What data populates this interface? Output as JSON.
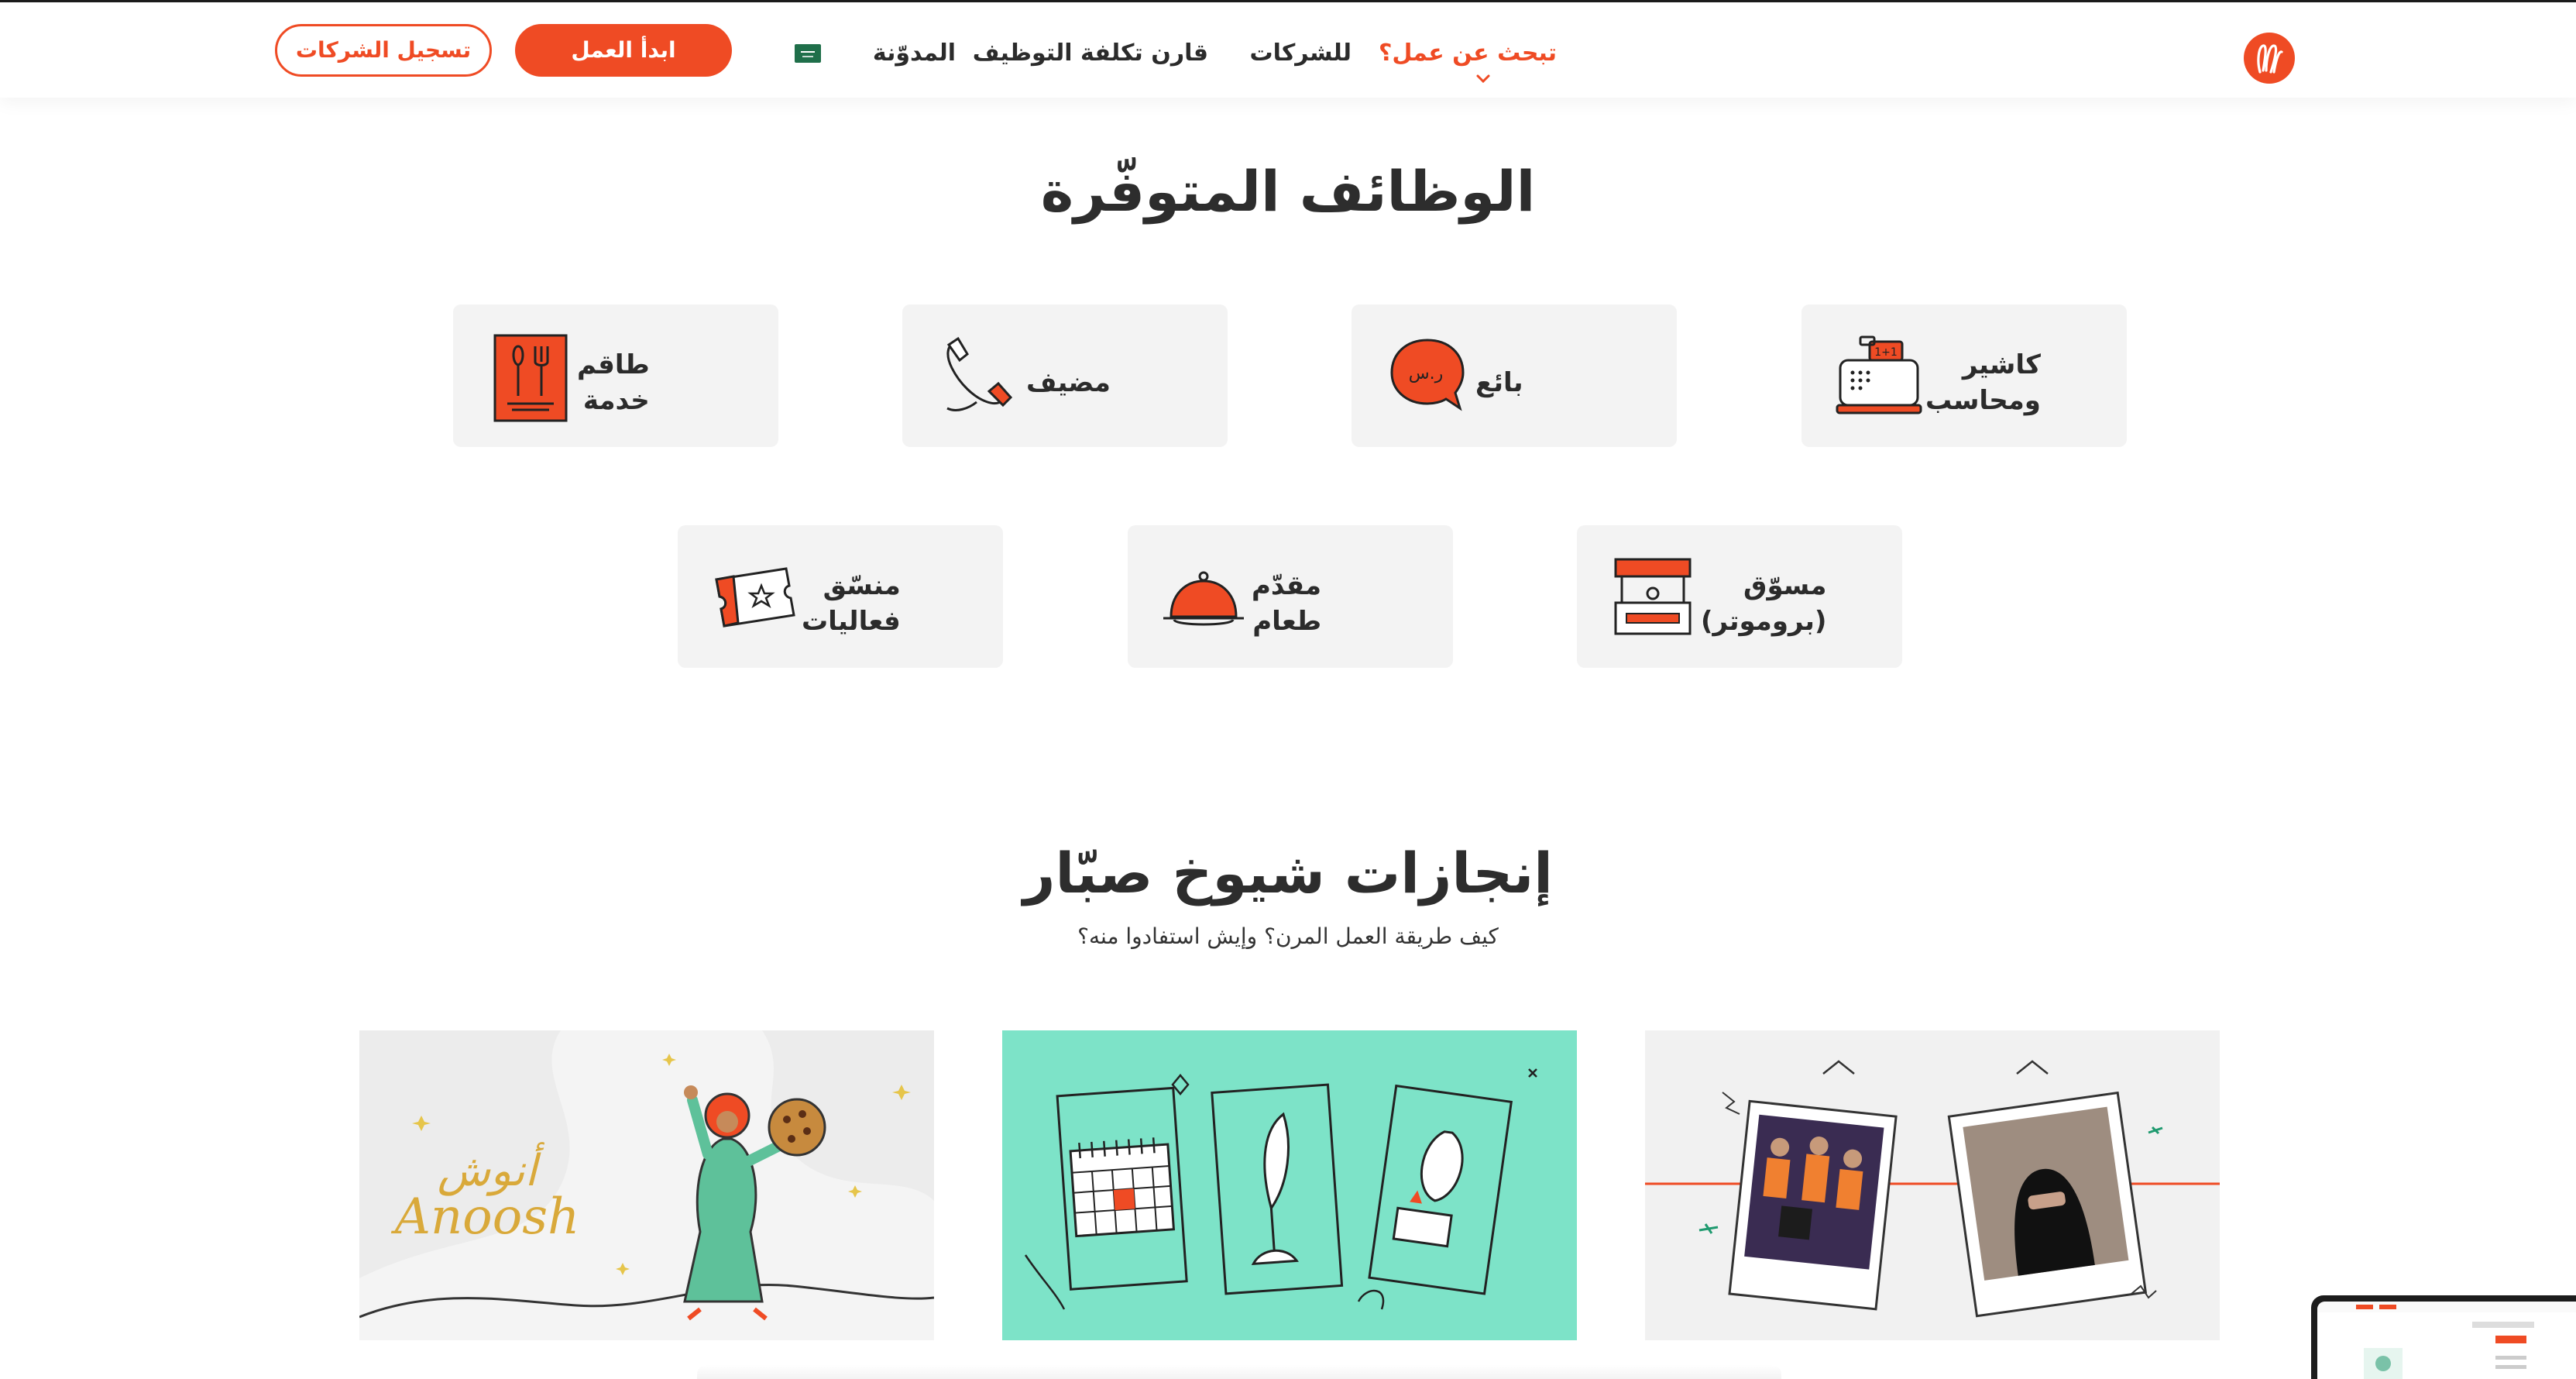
{
  "header": {
    "nav": {
      "find_job": "تبحث عن عمل؟",
      "companies": "للشركات",
      "compare_cost": "قارن تكلفة التوظيف",
      "blog": "المدوّنة"
    },
    "start_work": "ابدأ العمل",
    "register_companies": "تسجيل الشركات",
    "icons": {
      "logo": "brand-logo",
      "chevron": "chevron-down-icon",
      "language": "flag-icon"
    },
    "accent": "#ef4b24"
  },
  "jobs": {
    "title": "الوظائف المتوفّرة",
    "items": [
      {
        "label": "كاشير\nومحاسب",
        "icon": "cash-register-icon"
      },
      {
        "label": "بائع",
        "icon": "speech-bubble-icon"
      },
      {
        "label": "مضيف",
        "icon": "phone-icon"
      },
      {
        "label": "طاقم\nخدمة",
        "icon": "menu-cutlery-icon"
      },
      {
        "label": "مسوّق\n(بروموتر)",
        "icon": "promo-booth-icon"
      },
      {
        "label": "مقدّم\nطعام",
        "icon": "food-cloche-icon"
      },
      {
        "label": "منسّق\nفعاليات",
        "icon": "ticket-icon"
      }
    ]
  },
  "stories": {
    "title": "إنجازات شيوخ صبّار",
    "subtitle": "كيف طريقة العمل المرن؟ وإيش استفادوا منه؟",
    "cards": [
      {
        "illustration": "photos-frames"
      },
      {
        "illustration": "calendar-plant-money"
      },
      {
        "illustration": "anoosh-character",
        "brand_arabic": "أنوش",
        "brand_latin": "Anoosh"
      }
    ]
  }
}
